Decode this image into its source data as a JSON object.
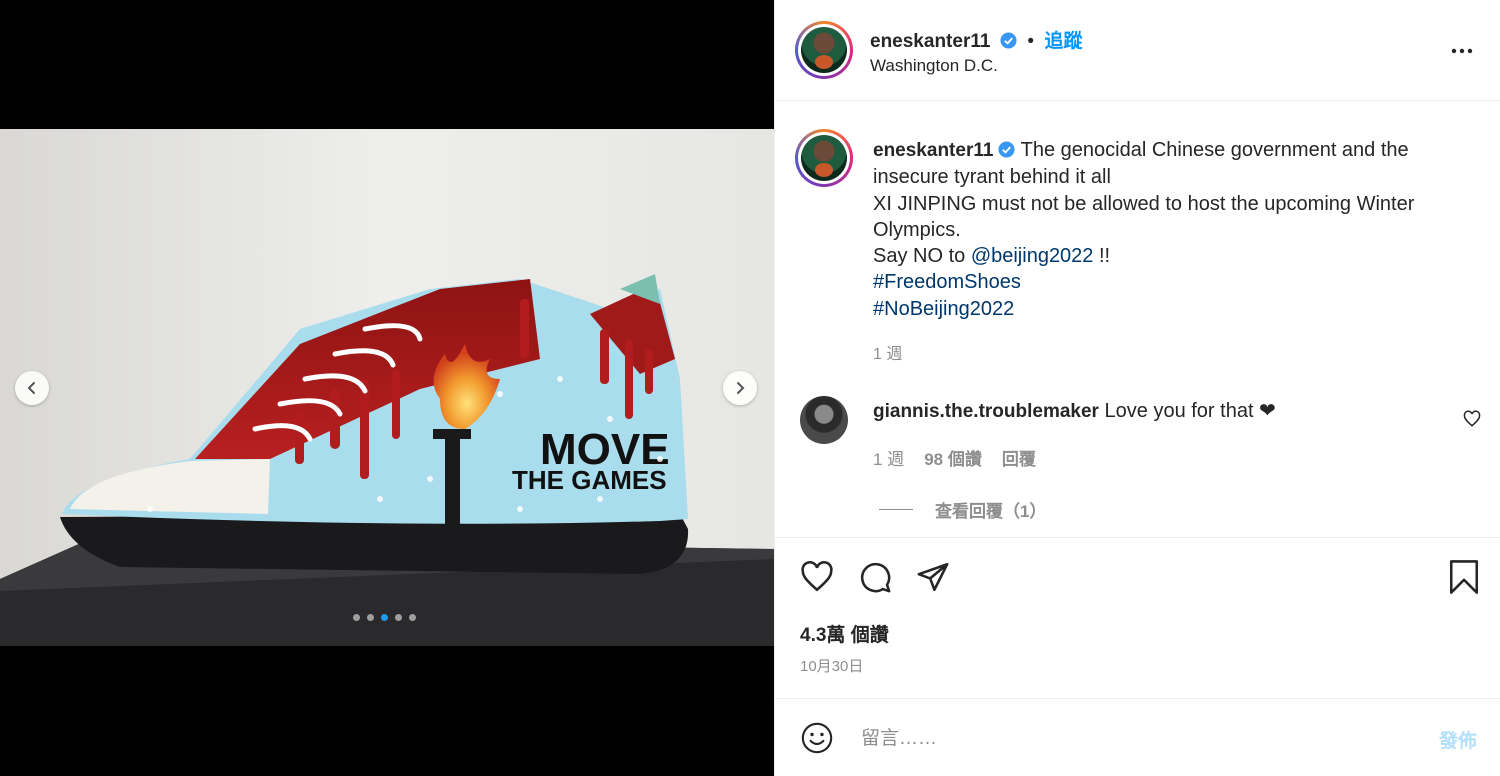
{
  "header": {
    "username": "eneskanter11",
    "separator": "•",
    "follow_label": "追蹤",
    "location": "Washington D.C.",
    "more_icon": "more-options-icon",
    "more_label": "•••"
  },
  "post_image": {
    "text_line1": "MOVE",
    "text_line2": "THE GAMES",
    "slide_count": 5,
    "active_slide": 3,
    "prev_icon": "chevron-left-icon",
    "next_icon": "chevron-right-icon"
  },
  "caption": {
    "username": "eneskanter11",
    "line1": "The genocidal Chinese government and the insecure tyrant behind it all",
    "line2": "XI JINPING must not be allowed to host the upcoming Winter Olympics.",
    "line3_prefix": "Say NO to ",
    "mention": "@beijing2022",
    "line3_suffix": " !!",
    "hashtag1": "#FreedomShoes",
    "hashtag2": "#NoBeijing2022",
    "time": "1 週"
  },
  "comment": {
    "username": "giannis.the.troublemaker",
    "text": "Love you for that ❤",
    "time": "1 週",
    "likes": "98 個讚",
    "reply_label": "回覆",
    "view_replies_label": "查看回覆（1）"
  },
  "actions": {
    "like_icon": "heart-icon",
    "comment_icon": "comment-icon",
    "share_icon": "paper-plane-icon",
    "save_icon": "bookmark-icon",
    "likes_count": "4.3萬 個讚",
    "date": "10月30日"
  },
  "comment_box": {
    "placeholder": "留言……",
    "post_label": "發佈",
    "emoji_icon": "emoji-icon"
  },
  "colors": {
    "accent_blue": "#0095f6",
    "link_dark": "#00376b",
    "muted": "#8e8e8e",
    "text": "#262626"
  }
}
